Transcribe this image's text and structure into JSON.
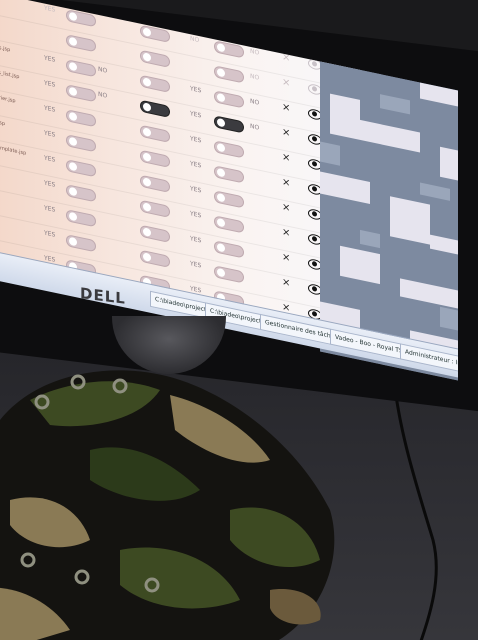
{
  "monitor": {
    "brand": "DELL"
  },
  "app_rows": [
    {
      "file": "",
      "col1": "YES",
      "col2": "NO",
      "col3": "YES",
      "col4": "NO",
      "faded": true
    },
    {
      "file": "",
      "col1": "YES",
      "col2": "",
      "col3": "NO",
      "col4": "NO",
      "faded": true
    },
    {
      "file": "",
      "col1": "",
      "col2": "",
      "col3": "",
      "col4": "NO",
      "faded": true
    },
    {
      "file": "abt_pos.jsp",
      "col1": "YES",
      "col2": "NO",
      "col3": "YES",
      "col4": "NO",
      "faded": false
    },
    {
      "file": "c_cards_list.jsp",
      "col1": "YES",
      "col2": "NO",
      "col3": "YES",
      "col4": "NO",
      "faded": false
    },
    {
      "file": "calendrier.jsp",
      "col1": "YES",
      "col2": "",
      "col3": "YES",
      "col4": "",
      "faded": false
    },
    {
      "file": "l_liste.jsp",
      "col1": "YES",
      "col2": "",
      "col3": "YES",
      "col4": "",
      "faded": false
    },
    {
      "file": "liste_template.jsp",
      "col1": "YES",
      "col2": "",
      "col3": "YES",
      "col4": "",
      "faded": false
    },
    {
      "file": "",
      "col1": "YES",
      "col2": "",
      "col3": "YES",
      "col4": "",
      "faded": false
    },
    {
      "file": "e.jsp",
      "col1": "YES",
      "col2": "",
      "col3": "YES",
      "col4": "",
      "faded": false
    },
    {
      "file": "",
      "col1": "YES",
      "col2": "",
      "col3": "YES",
      "col4": "",
      "faded": false
    },
    {
      "file": "",
      "col1": "YES",
      "col2": "",
      "col3": "YES",
      "col4": "",
      "faded": false
    }
  ],
  "taskbar": {
    "items": [
      "Gestionnaire des tâch...",
      "Vadeo - Boo - Royal TS",
      "Administrateur : Inv"
    ],
    "paths": [
      "C:\\biadeo\\project\\...",
      "C:\\biadeo\\project\\a..."
    ]
  },
  "colors": {
    "camo_green": "#3d4a22",
    "camo_tan": "#8a7a55",
    "camo_black": "#141310",
    "digital_camo_blue": "#7d8aa0",
    "digital_camo_light": "#e6e4ee"
  }
}
